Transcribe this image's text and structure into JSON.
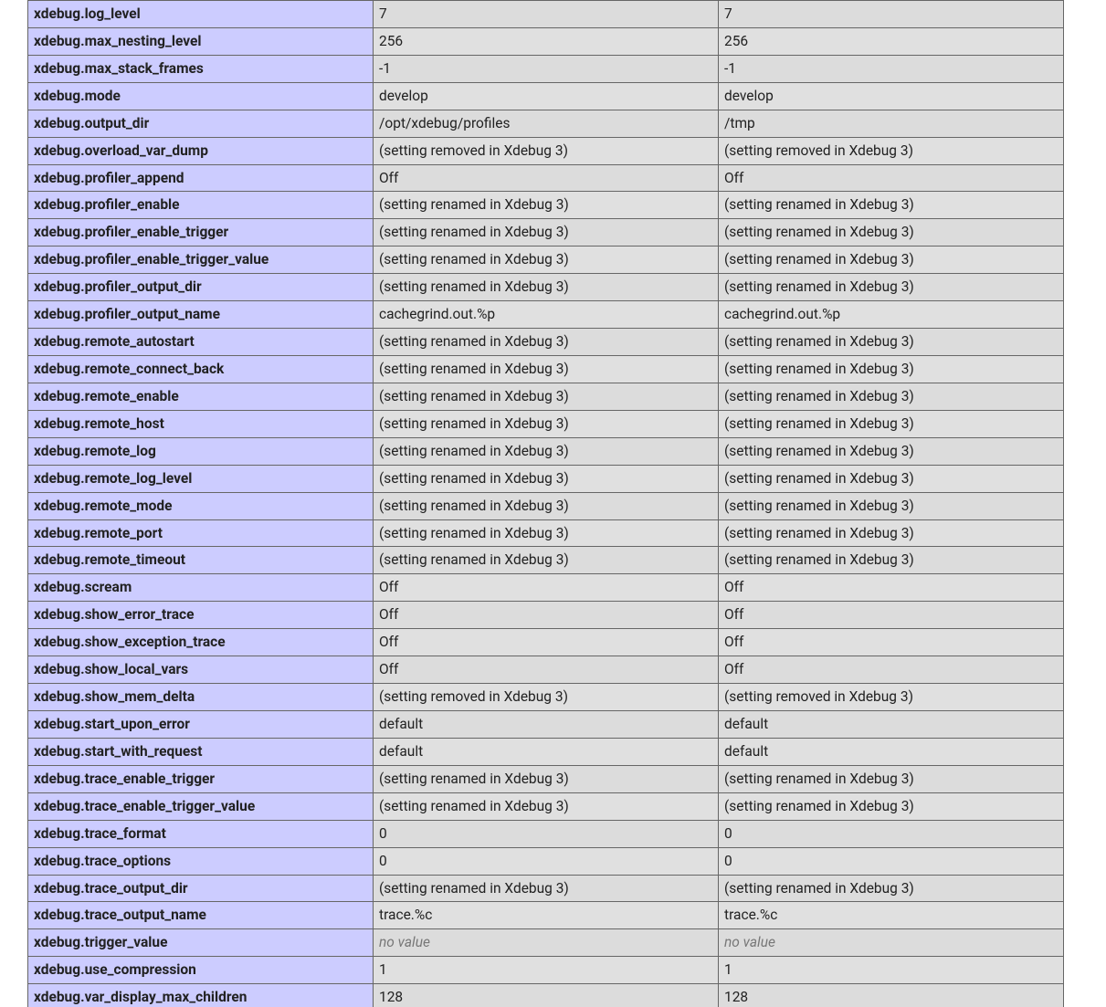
{
  "rows": [
    {
      "directive": "xdebug.log_level",
      "local": "7",
      "master": "7"
    },
    {
      "directive": "xdebug.max_nesting_level",
      "local": "256",
      "master": "256"
    },
    {
      "directive": "xdebug.max_stack_frames",
      "local": "-1",
      "master": "-1"
    },
    {
      "directive": "xdebug.mode",
      "local": "develop",
      "master": "develop"
    },
    {
      "directive": "xdebug.output_dir",
      "local": "/opt/xdebug/profiles",
      "master": "/tmp"
    },
    {
      "directive": "xdebug.overload_var_dump",
      "local": "(setting removed in Xdebug 3)",
      "master": "(setting removed in Xdebug 3)"
    },
    {
      "directive": "xdebug.profiler_append",
      "local": "Off",
      "master": "Off"
    },
    {
      "directive": "xdebug.profiler_enable",
      "local": "(setting renamed in Xdebug 3)",
      "master": "(setting renamed in Xdebug 3)"
    },
    {
      "directive": "xdebug.profiler_enable_trigger",
      "local": "(setting renamed in Xdebug 3)",
      "master": "(setting renamed in Xdebug 3)"
    },
    {
      "directive": "xdebug.profiler_enable_trigger_value",
      "local": "(setting renamed in Xdebug 3)",
      "master": "(setting renamed in Xdebug 3)"
    },
    {
      "directive": "xdebug.profiler_output_dir",
      "local": "(setting renamed in Xdebug 3)",
      "master": "(setting renamed in Xdebug 3)"
    },
    {
      "directive": "xdebug.profiler_output_name",
      "local": "cachegrind.out.%p",
      "master": "cachegrind.out.%p"
    },
    {
      "directive": "xdebug.remote_autostart",
      "local": "(setting renamed in Xdebug 3)",
      "master": "(setting renamed in Xdebug 3)"
    },
    {
      "directive": "xdebug.remote_connect_back",
      "local": "(setting renamed in Xdebug 3)",
      "master": "(setting renamed in Xdebug 3)"
    },
    {
      "directive": "xdebug.remote_enable",
      "local": "(setting renamed in Xdebug 3)",
      "master": "(setting renamed in Xdebug 3)"
    },
    {
      "directive": "xdebug.remote_host",
      "local": "(setting renamed in Xdebug 3)",
      "master": "(setting renamed in Xdebug 3)"
    },
    {
      "directive": "xdebug.remote_log",
      "local": "(setting renamed in Xdebug 3)",
      "master": "(setting renamed in Xdebug 3)"
    },
    {
      "directive": "xdebug.remote_log_level",
      "local": "(setting renamed in Xdebug 3)",
      "master": "(setting renamed in Xdebug 3)"
    },
    {
      "directive": "xdebug.remote_mode",
      "local": "(setting renamed in Xdebug 3)",
      "master": "(setting renamed in Xdebug 3)"
    },
    {
      "directive": "xdebug.remote_port",
      "local": "(setting renamed in Xdebug 3)",
      "master": "(setting renamed in Xdebug 3)"
    },
    {
      "directive": "xdebug.remote_timeout",
      "local": "(setting renamed in Xdebug 3)",
      "master": "(setting renamed in Xdebug 3)"
    },
    {
      "directive": "xdebug.scream",
      "local": "Off",
      "master": "Off"
    },
    {
      "directive": "xdebug.show_error_trace",
      "local": "Off",
      "master": "Off"
    },
    {
      "directive": "xdebug.show_exception_trace",
      "local": "Off",
      "master": "Off"
    },
    {
      "directive": "xdebug.show_local_vars",
      "local": "Off",
      "master": "Off"
    },
    {
      "directive": "xdebug.show_mem_delta",
      "local": "(setting removed in Xdebug 3)",
      "master": "(setting removed in Xdebug 3)"
    },
    {
      "directive": "xdebug.start_upon_error",
      "local": "default",
      "master": "default"
    },
    {
      "directive": "xdebug.start_with_request",
      "local": "default",
      "master": "default"
    },
    {
      "directive": "xdebug.trace_enable_trigger",
      "local": "(setting renamed in Xdebug 3)",
      "master": "(setting renamed in Xdebug 3)"
    },
    {
      "directive": "xdebug.trace_enable_trigger_value",
      "local": "(setting renamed in Xdebug 3)",
      "master": "(setting renamed in Xdebug 3)"
    },
    {
      "directive": "xdebug.trace_format",
      "local": "0",
      "master": "0"
    },
    {
      "directive": "xdebug.trace_options",
      "local": "0",
      "master": "0"
    },
    {
      "directive": "xdebug.trace_output_dir",
      "local": "(setting renamed in Xdebug 3)",
      "master": "(setting renamed in Xdebug 3)"
    },
    {
      "directive": "xdebug.trace_output_name",
      "local": "trace.%c",
      "master": "trace.%c"
    },
    {
      "directive": "xdebug.trigger_value",
      "local": "no value",
      "master": "no value",
      "novalue": true
    },
    {
      "directive": "xdebug.use_compression",
      "local": "1",
      "master": "1"
    },
    {
      "directive": "xdebug.var_display_max_children",
      "local": "128",
      "master": "128",
      "cutoff": true
    }
  ]
}
